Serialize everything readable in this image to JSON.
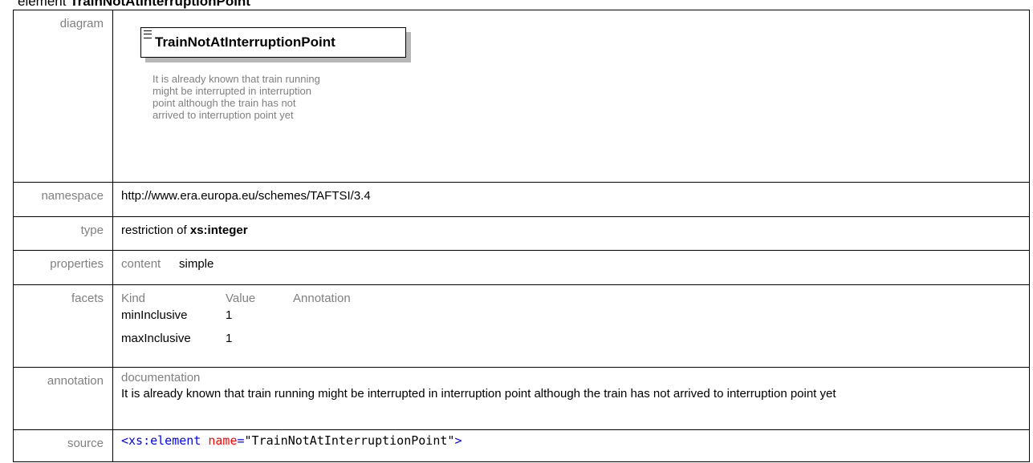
{
  "heading": {
    "prefix": "element",
    "name": "TrainNotAtInterruptionPoint"
  },
  "labels": {
    "diagram": "diagram",
    "namespace": "namespace",
    "type": "type",
    "properties": "properties",
    "facets": "facets",
    "annotation": "annotation",
    "source": "source"
  },
  "diagram": {
    "element_name": "TrainNotAtInterruptionPoint",
    "description_lines": [
      "It is already known that train running",
      "might be interrupted in interruption",
      "point although the train has not",
      "arrived to interruption point yet"
    ]
  },
  "namespace": "http://www.era.europa.eu/schemes/TAFTSI/3.4",
  "type": {
    "prefix": "restriction of ",
    "base": "xs:integer"
  },
  "properties": {
    "key": "content",
    "value": "simple"
  },
  "facets": {
    "headers": [
      "Kind",
      "Value",
      "Annotation"
    ],
    "rows": [
      {
        "kind": "minInclusive",
        "value": "1"
      },
      {
        "kind": "maxInclusive",
        "value": "1"
      }
    ]
  },
  "annotation": {
    "label": "documentation",
    "text": "It is already known that train running might be interrupted in interruption point although the train has not arrived to interruption point yet"
  },
  "source": {
    "open": "<xs:element ",
    "attr": "name",
    "eq": "=",
    "value": "\"TrainNotAtInterruptionPoint\"",
    "close": ">"
  },
  "colors": {
    "label_gray": "#808080",
    "tag_blue": "#0000ff",
    "attr_red": "#ff0000",
    "shadow_gray": "#b7b7b7"
  }
}
